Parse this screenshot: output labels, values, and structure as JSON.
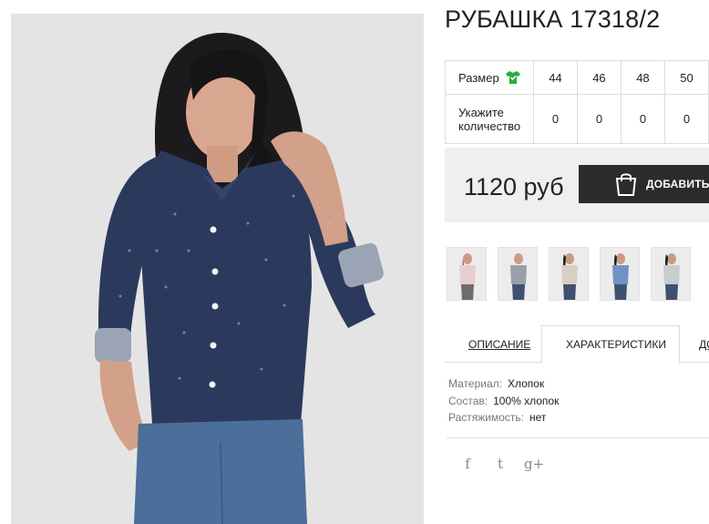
{
  "product": {
    "title": "РУБАШКА 17318/2",
    "price": "1120 руб",
    "add_to_cart_label": "ДОБАВИТЬ В КОРЗИНУ"
  },
  "size_table": {
    "size_label": "Размер",
    "qty_label": "Укажите количество",
    "sizes": [
      "44",
      "46",
      "48",
      "50"
    ],
    "quantities": [
      "0",
      "0",
      "0",
      "0"
    ]
  },
  "tabs": [
    {
      "label": "ОПИСАНИЕ"
    },
    {
      "label": "ХАРАКТЕРИСТИКИ"
    },
    {
      "label": "ДО"
    }
  ],
  "characteristics": [
    {
      "key": "Материал:",
      "value": "Хлопок"
    },
    {
      "key": "Состав:",
      "value": "100% хлопок"
    },
    {
      "key": "Растяжимость:",
      "value": "нет"
    }
  ],
  "social": {
    "facebook": "f",
    "twitter": "t",
    "google_plus": "g+"
  },
  "colors": {
    "accent": "#2b2b2b",
    "size_icon": "#27ae3e",
    "price_box_bg": "#efefef",
    "shirt_color": "#2b3a5c"
  },
  "icons": [
    "shirt-size-icon",
    "shopping-bag-icon",
    "facebook-icon",
    "twitter-icon",
    "google-plus-icon"
  ]
}
